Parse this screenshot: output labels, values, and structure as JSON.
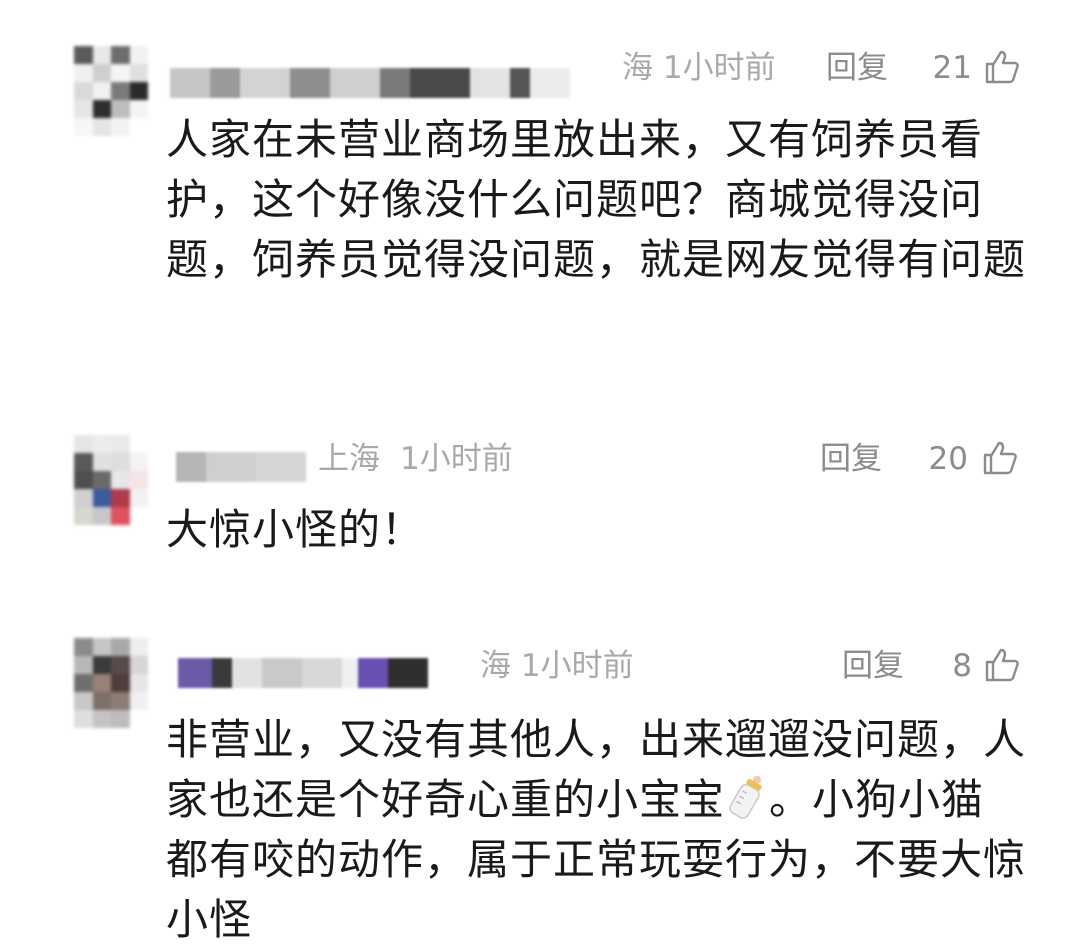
{
  "comments": [
    {
      "location_time": "海 1小时前",
      "reply_label": "回复",
      "like_count": "21",
      "text": "人家在未营业商场里放出来，又有饲养员看护，这个好像没什么问题吧？商城觉得没问题，饲养员觉得没问题，就是网友觉得有问题",
      "icon": "thumbs-up-icon"
    },
    {
      "location": "上海",
      "time": "1小时前",
      "reply_label": "回复",
      "like_count": "20",
      "text": "大惊小怪的！",
      "icon": "thumbs-up-icon"
    },
    {
      "location_time": "海 1小时前",
      "reply_label": "回复",
      "like_count": "8",
      "text_part1": "非营业，又没有其他人，出来遛遛没问题，人家也还是个好奇心重的小宝宝",
      "text_part2": "。小狗小猫都有咬的动作，属于正常玩耍行为，不要大惊小怪",
      "icons": [
        "baby-bottle-icon",
        "thumbs-up-icon"
      ]
    }
  ]
}
